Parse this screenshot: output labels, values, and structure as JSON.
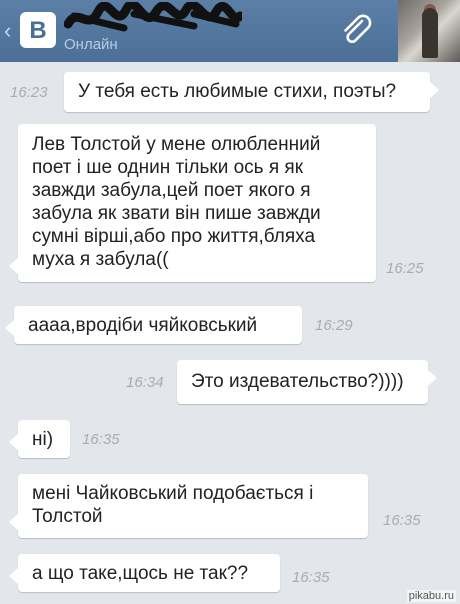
{
  "header": {
    "logo_letter": "В",
    "contact_status": "Онлайн"
  },
  "messages": [
    {
      "direction": "out",
      "text": "У тебя есть любимые стихи, поэты?",
      "time": "16:23"
    },
    {
      "direction": "in",
      "text": "Лев Толстой у мене олюбленний поет і ше однин тільки ось я як завжди забула,цей поет якого я забула як звати він пише завжди сумні вірші,або про життя,бляха муха я забула((",
      "time": "16:25"
    },
    {
      "direction": "in",
      "text": "аааа,вродіби чяйковський",
      "time": "16:29"
    },
    {
      "direction": "out",
      "text": "Это издевательство?))))",
      "time": "16:34"
    },
    {
      "direction": "in",
      "text": "ні)",
      "time": "16:35"
    },
    {
      "direction": "in",
      "text": "мені Чайковський подобається і Толстой",
      "time": "16:35"
    },
    {
      "direction": "in",
      "text": "а що таке,щось не так??",
      "time": "16:35"
    }
  ],
  "watermark": "pikabu.ru",
  "colors": {
    "header": "#4b6f97",
    "background": "#e3e6ea",
    "bubble": "#ffffff",
    "time": "#a7adb5"
  },
  "icons": {
    "back": "chevron-left-icon",
    "attach": "paperclip-icon"
  }
}
